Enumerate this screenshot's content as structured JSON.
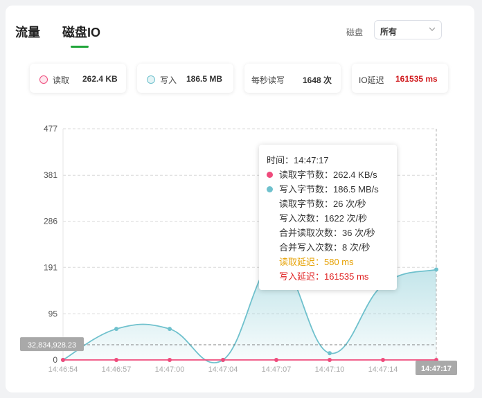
{
  "tabs": [
    {
      "label": "流量",
      "active": false
    },
    {
      "label": "磁盘IO",
      "active": true
    }
  ],
  "disk_filter": {
    "label": "磁盘",
    "selected": "所有"
  },
  "stats": {
    "read": {
      "label": "读取",
      "value": "262.4 KB"
    },
    "write": {
      "label": "写入",
      "value": "186.5 MB"
    },
    "iops": {
      "label": "每秒读写",
      "value": "1648 次"
    },
    "latency": {
      "label": "IO延迟",
      "value": "161535 ms"
    }
  },
  "colors": {
    "accent": "#20a53a",
    "read_series": "#ef4b7c",
    "write_series": "#6fc1cd",
    "latency_red": "#d0191c",
    "read_latency_orange": "#e6a000"
  },
  "chart_data": {
    "type": "line",
    "x": [
      "14:46:54",
      "14:46:57",
      "14:47:00",
      "14:47:04",
      "14:47:07",
      "14:47:10",
      "14:47:14",
      "14:47:17"
    ],
    "series": [
      {
        "name": "读取字节数",
        "values": [
          0,
          0,
          0,
          0,
          0,
          0,
          0,
          0
        ]
      },
      {
        "name": "写入字节数",
        "values": [
          0,
          64,
          64,
          0,
          205,
          14,
          155,
          186.5
        ]
      }
    ],
    "y_ticks": [
      "0",
      "95",
      "191",
      "286",
      "381",
      "477"
    ],
    "ylim": [
      0,
      477
    ],
    "grid": true,
    "crosshair": {
      "x_label": "14:47:17",
      "y_label": "32,834,928.23",
      "y_value": 31.3
    }
  },
  "tooltip": {
    "time": "时间：14:47:17",
    "read_bytes": "读取字节数：262.4 KB/s",
    "write_bytes": "写入字节数：186.5 MB/s",
    "read_count": "读取字节数：26 次/秒",
    "write_count": "写入次数：1622 次/秒",
    "merge_read": "合并读取次数：36 次/秒",
    "merge_write": "合并写入次数：8 次/秒",
    "read_latency": "读取延迟：580 ms",
    "write_latency": "写入延迟：161535 ms"
  }
}
